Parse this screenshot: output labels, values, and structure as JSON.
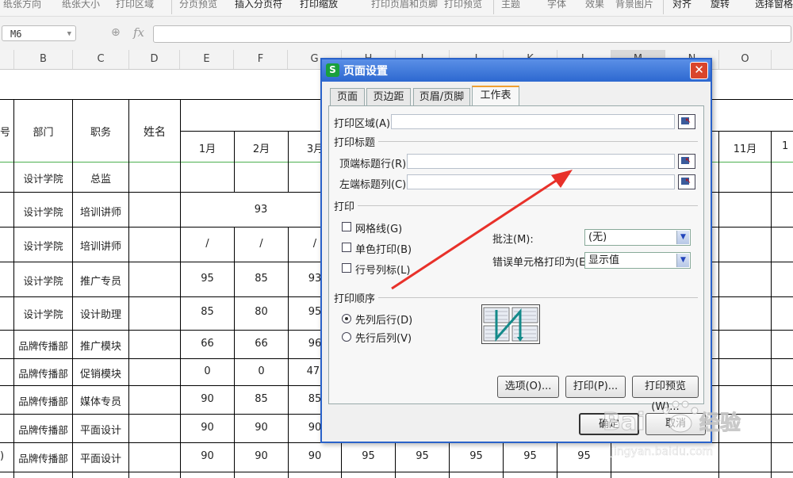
{
  "ribbon": {
    "items": [
      "纸张方向",
      "纸张大小",
      "打印区域",
      "分页预览",
      "插入分页符",
      "打印缩放",
      "打印页眉和页脚",
      "打印预览",
      "主题",
      "字体",
      "效果",
      "背景图片",
      "对齐",
      "旋转",
      "选择窗格"
    ]
  },
  "formula_bar": {
    "name_box": "M6",
    "fx": "fx",
    "value": ""
  },
  "columns": [
    "B",
    "C",
    "D",
    "E",
    "F",
    "G",
    "H",
    "I",
    "J",
    "K",
    "L",
    "M",
    "N",
    "O"
  ],
  "sheet": {
    "header_partial_left": "号",
    "headers": {
      "dept": "部门",
      "role": "职务",
      "name": "姓名"
    },
    "months": [
      "1月",
      "2月",
      "3月",
      "11月",
      "1"
    ],
    "rows": [
      {
        "dept": "设计学院",
        "role": "总监",
        "vals": [
          "",
          "",
          ""
        ]
      },
      {
        "dept": "设计学院",
        "role": "培训讲师",
        "merged": "93"
      },
      {
        "dept": "设计学院",
        "role": "培训讲师",
        "vals": [
          "/",
          "/",
          "/"
        ]
      },
      {
        "dept": "设计学院",
        "role": "推广专员",
        "vals": [
          "95",
          "85",
          "93"
        ]
      },
      {
        "dept": "设计学院",
        "role": "设计助理",
        "vals": [
          "85",
          "80",
          "95"
        ]
      },
      {
        "dept": "品牌传播部",
        "role": "推广模块",
        "vals": [
          "66",
          "66",
          "96"
        ]
      },
      {
        "dept": "品牌传播部",
        "role": "促销模块",
        "vals": [
          "0",
          "0",
          "47."
        ]
      },
      {
        "dept": "品牌传播部",
        "role": "媒体专员",
        "vals": [
          "90",
          "85",
          "85"
        ]
      },
      {
        "dept": "品牌传播部",
        "role": "平面设计",
        "vals": [
          "90",
          "90",
          "90"
        ]
      },
      {
        "dept": "品牌传播部",
        "role": "平面设计",
        "vals": [
          "90",
          "90",
          "90",
          "95",
          "95",
          "95",
          "95",
          "95"
        ],
        "left_partial": ")"
      }
    ]
  },
  "dialog": {
    "title": "页面设置",
    "close": "✕",
    "tabs": [
      "页面",
      "页边距",
      "页眉/页脚",
      "工作表"
    ],
    "active_tab": "工作表",
    "print_area_label": "打印区域(A):",
    "print_area_value": "",
    "print_titles_section": "打印标题",
    "top_rows_label": "顶端标题行(R):",
    "top_rows_value": "",
    "left_cols_label": "左端标题列(C):",
    "left_cols_value": "",
    "print_section": "打印",
    "gridlines_label": "网格线(G)",
    "gridlines_checked": false,
    "mono_label": "单色打印(B)",
    "mono_checked": false,
    "rowcol_label": "行号列标(L)",
    "rowcol_checked": false,
    "comments_label": "批注(M):",
    "comments_value": "(无)",
    "errors_label": "错误单元格打印为(E):",
    "errors_value": "显示值",
    "order_section": "打印顺序",
    "order_down_then_over": "先列后行(D)",
    "order_over_then_down": "先行后列(V)",
    "order_selected": "先列后行(D)",
    "buttons": {
      "options": "选项(O)...",
      "print": "打印(P)...",
      "preview": "打印预览(W)..."
    },
    "ok": "确定",
    "cancel": "取消"
  },
  "watermark": {
    "brand": "Bai",
    "brand2": "经验",
    "url": "jingyan.baidu.com"
  },
  "colors": {
    "dialog_border": "#2a62c9",
    "arrow": "#e8312a",
    "close": "#d9452b",
    "tab_accent": "#f0a030"
  }
}
